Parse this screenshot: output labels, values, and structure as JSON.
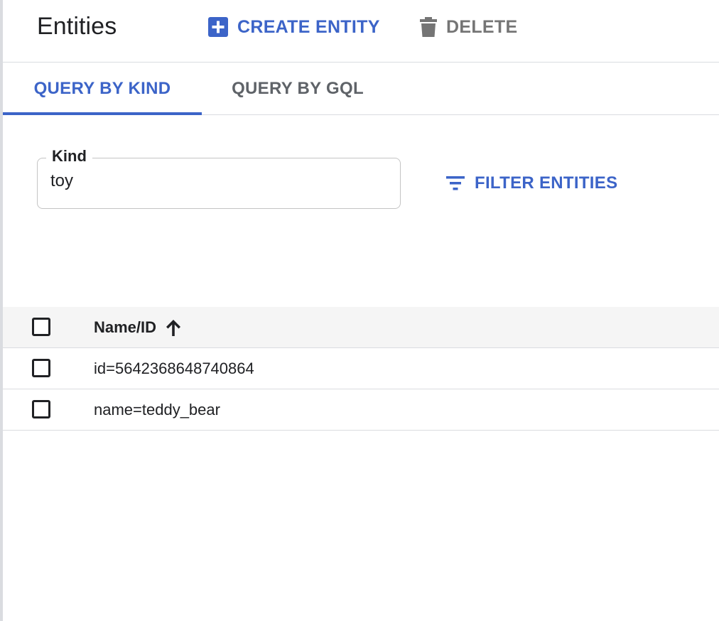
{
  "toolbar": {
    "title": "Entities",
    "create_label": "CREATE ENTITY",
    "create_icon": "add-box-icon",
    "delete_label": "DELETE",
    "delete_icon": "trash-icon"
  },
  "tabs": [
    {
      "label": "QUERY BY KIND",
      "active": true
    },
    {
      "label": "QUERY BY GQL",
      "active": false
    }
  ],
  "kind_field": {
    "label": "Kind",
    "value": "toy"
  },
  "filter": {
    "label": "FILTER ENTITIES",
    "icon": "filter-list-icon"
  },
  "table": {
    "columns": [
      {
        "label": "Name/ID",
        "sort": "ascending",
        "sort_icon": "arrow-up-icon"
      }
    ],
    "rows": [
      {
        "name_id": "id=5642368648740864"
      },
      {
        "name_id": "name=teddy_bear"
      }
    ]
  },
  "colors": {
    "accent": "#3c64c8",
    "muted": "#757575",
    "header_bg": "#f5f5f5",
    "divider": "#dadce0"
  }
}
